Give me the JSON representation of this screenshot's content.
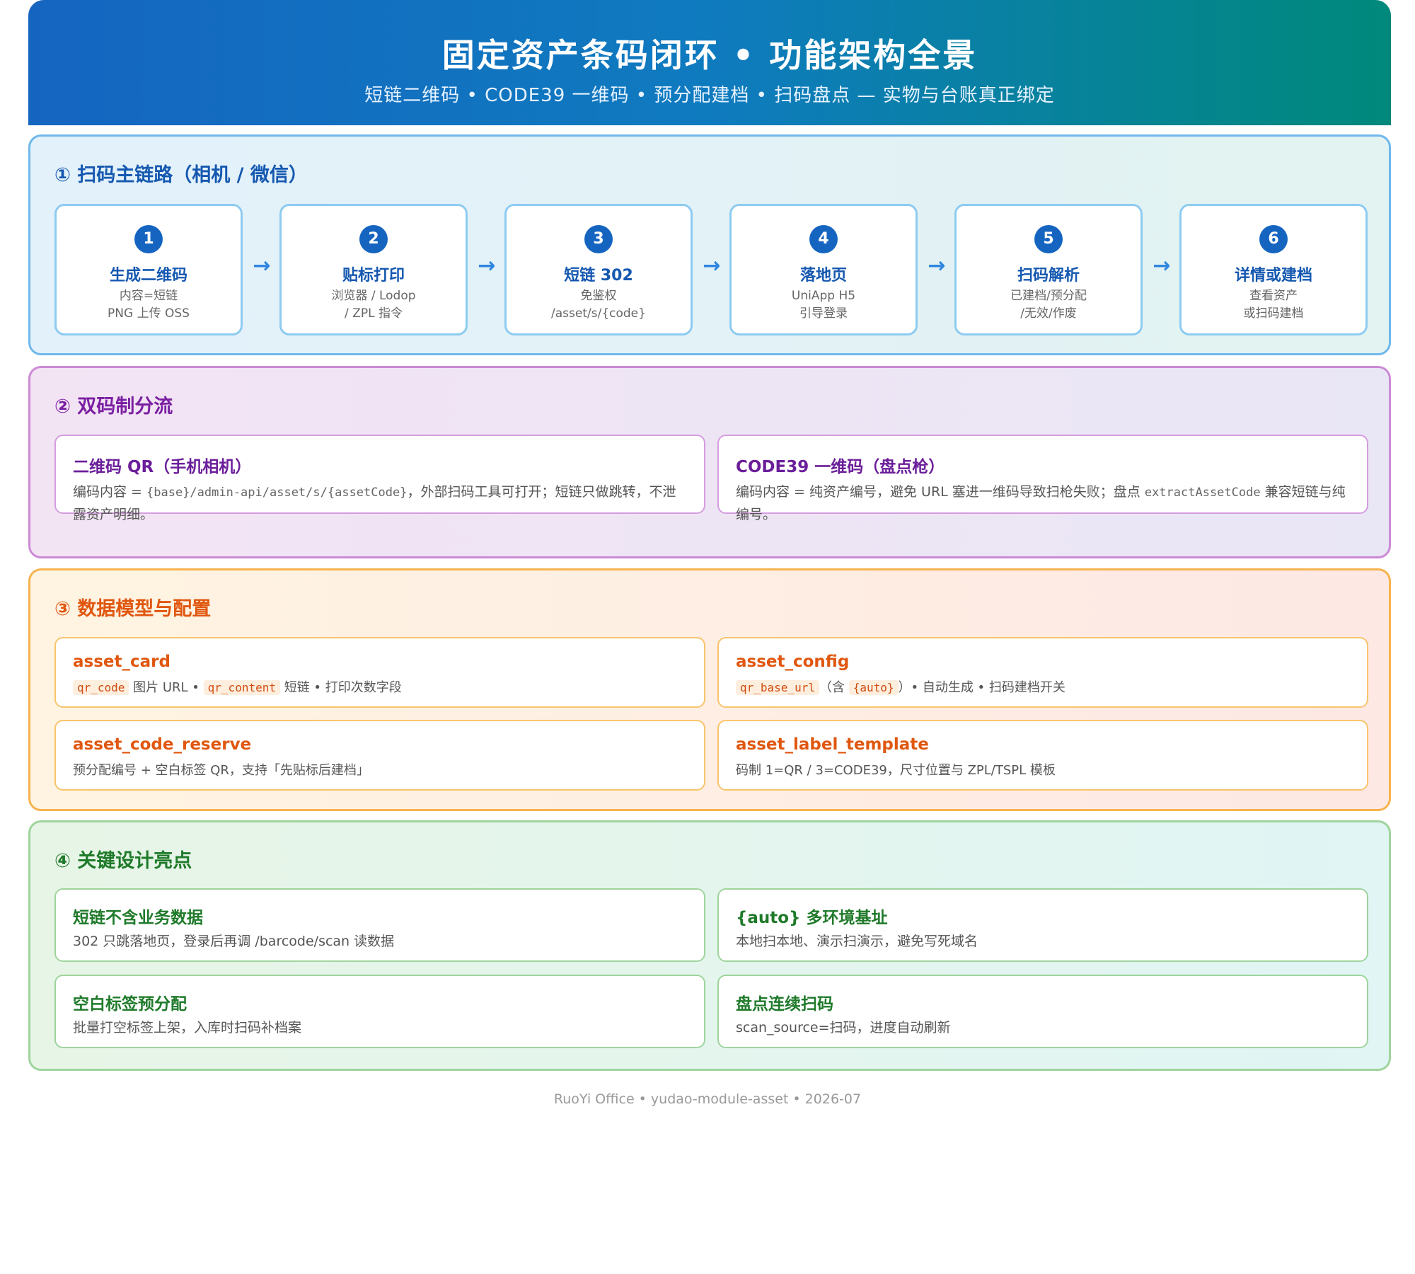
{
  "header": {
    "title": "固定资产条码闭环 • 功能架构全景",
    "subtitle": "短链二维码 • CODE39 一维码 • 预分配建档 • 扫码盘点 — 实物与台账真正绑定"
  },
  "section1": {
    "title": "① 扫码主链路（相机 / 微信）",
    "arrow": "→",
    "steps": [
      {
        "num": "1",
        "title": "生成二维码",
        "desc1": "内容=短链",
        "desc2": "PNG 上传 OSS"
      },
      {
        "num": "2",
        "title": "贴标打印",
        "desc1": "浏览器 / Lodop",
        "desc2": "/ ZPL 指令"
      },
      {
        "num": "3",
        "title": "短链 302",
        "desc1": "免鉴权",
        "desc2": "/asset/s/{code}"
      },
      {
        "num": "4",
        "title": "落地页",
        "desc1": "UniApp H5",
        "desc2": "引导登录"
      },
      {
        "num": "5",
        "title": "扫码解析",
        "desc1": "已建档/预分配",
        "desc2": "/无效/作废"
      },
      {
        "num": "6",
        "title": "详情或建档",
        "desc1": "查看资产",
        "desc2": "或扫码建档"
      }
    ]
  },
  "section2": {
    "title": "② 双码制分流",
    "qr": {
      "title": "二维码 QR（手机相机）",
      "desc_pre": "编码内容 = ",
      "desc_code": "{base}/admin-api/asset/s/{assetCode}",
      "desc_post": "，外部扫码工具可打开；短链只做跳转，不泄露资产明细。"
    },
    "code39": {
      "title": "CODE39 一维码（盘点枪）",
      "desc_pre": "编码内容 = 纯资产编号，避免 URL 塞进一维码导致扫枪失败；盘点 ",
      "desc_code": "extractAssetCode",
      "desc_post": " 兼容短链与纯编号。"
    }
  },
  "section3": {
    "title": "③ 数据模型与配置",
    "asset_card": {
      "title": "asset_card",
      "tag1": "qr_code",
      "text1": " 图片 URL • ",
      "tag2": "qr_content",
      "text2": " 短链 • 打印次数字段"
    },
    "asset_config": {
      "title": "asset_config",
      "tag1": "qr_base_url",
      "text1": "（含 ",
      "tag2": "{auto}",
      "text2": "）• 自动生成 • 扫码建档开关"
    },
    "asset_code_reserve": {
      "title": "asset_code_reserve",
      "desc": "预分配编号 + 空白标签 QR，支持「先贴标后建档」"
    },
    "asset_label_template": {
      "title": "asset_label_template",
      "desc": "码制 1=QR / 3=CODE39，尺寸位置与 ZPL/TSPL 模板"
    }
  },
  "section4": {
    "title": "④ 关键设计亮点",
    "cards": [
      {
        "title": "短链不含业务数据",
        "desc": "302 只跳落地页，登录后再调 /barcode/scan 读数据"
      },
      {
        "title": "{auto} 多环境基址",
        "desc": "本地扫本地、演示扫演示，避免写死域名"
      },
      {
        "title": "空白标签预分配",
        "desc": "批量打空标签上架，入库时扫码补档案"
      },
      {
        "title": "盘点连续扫码",
        "desc": "scan_source=扫码，进度自动刷新"
      }
    ]
  },
  "footer": "RuoYi Office • yudao-module-asset • 2026-07"
}
